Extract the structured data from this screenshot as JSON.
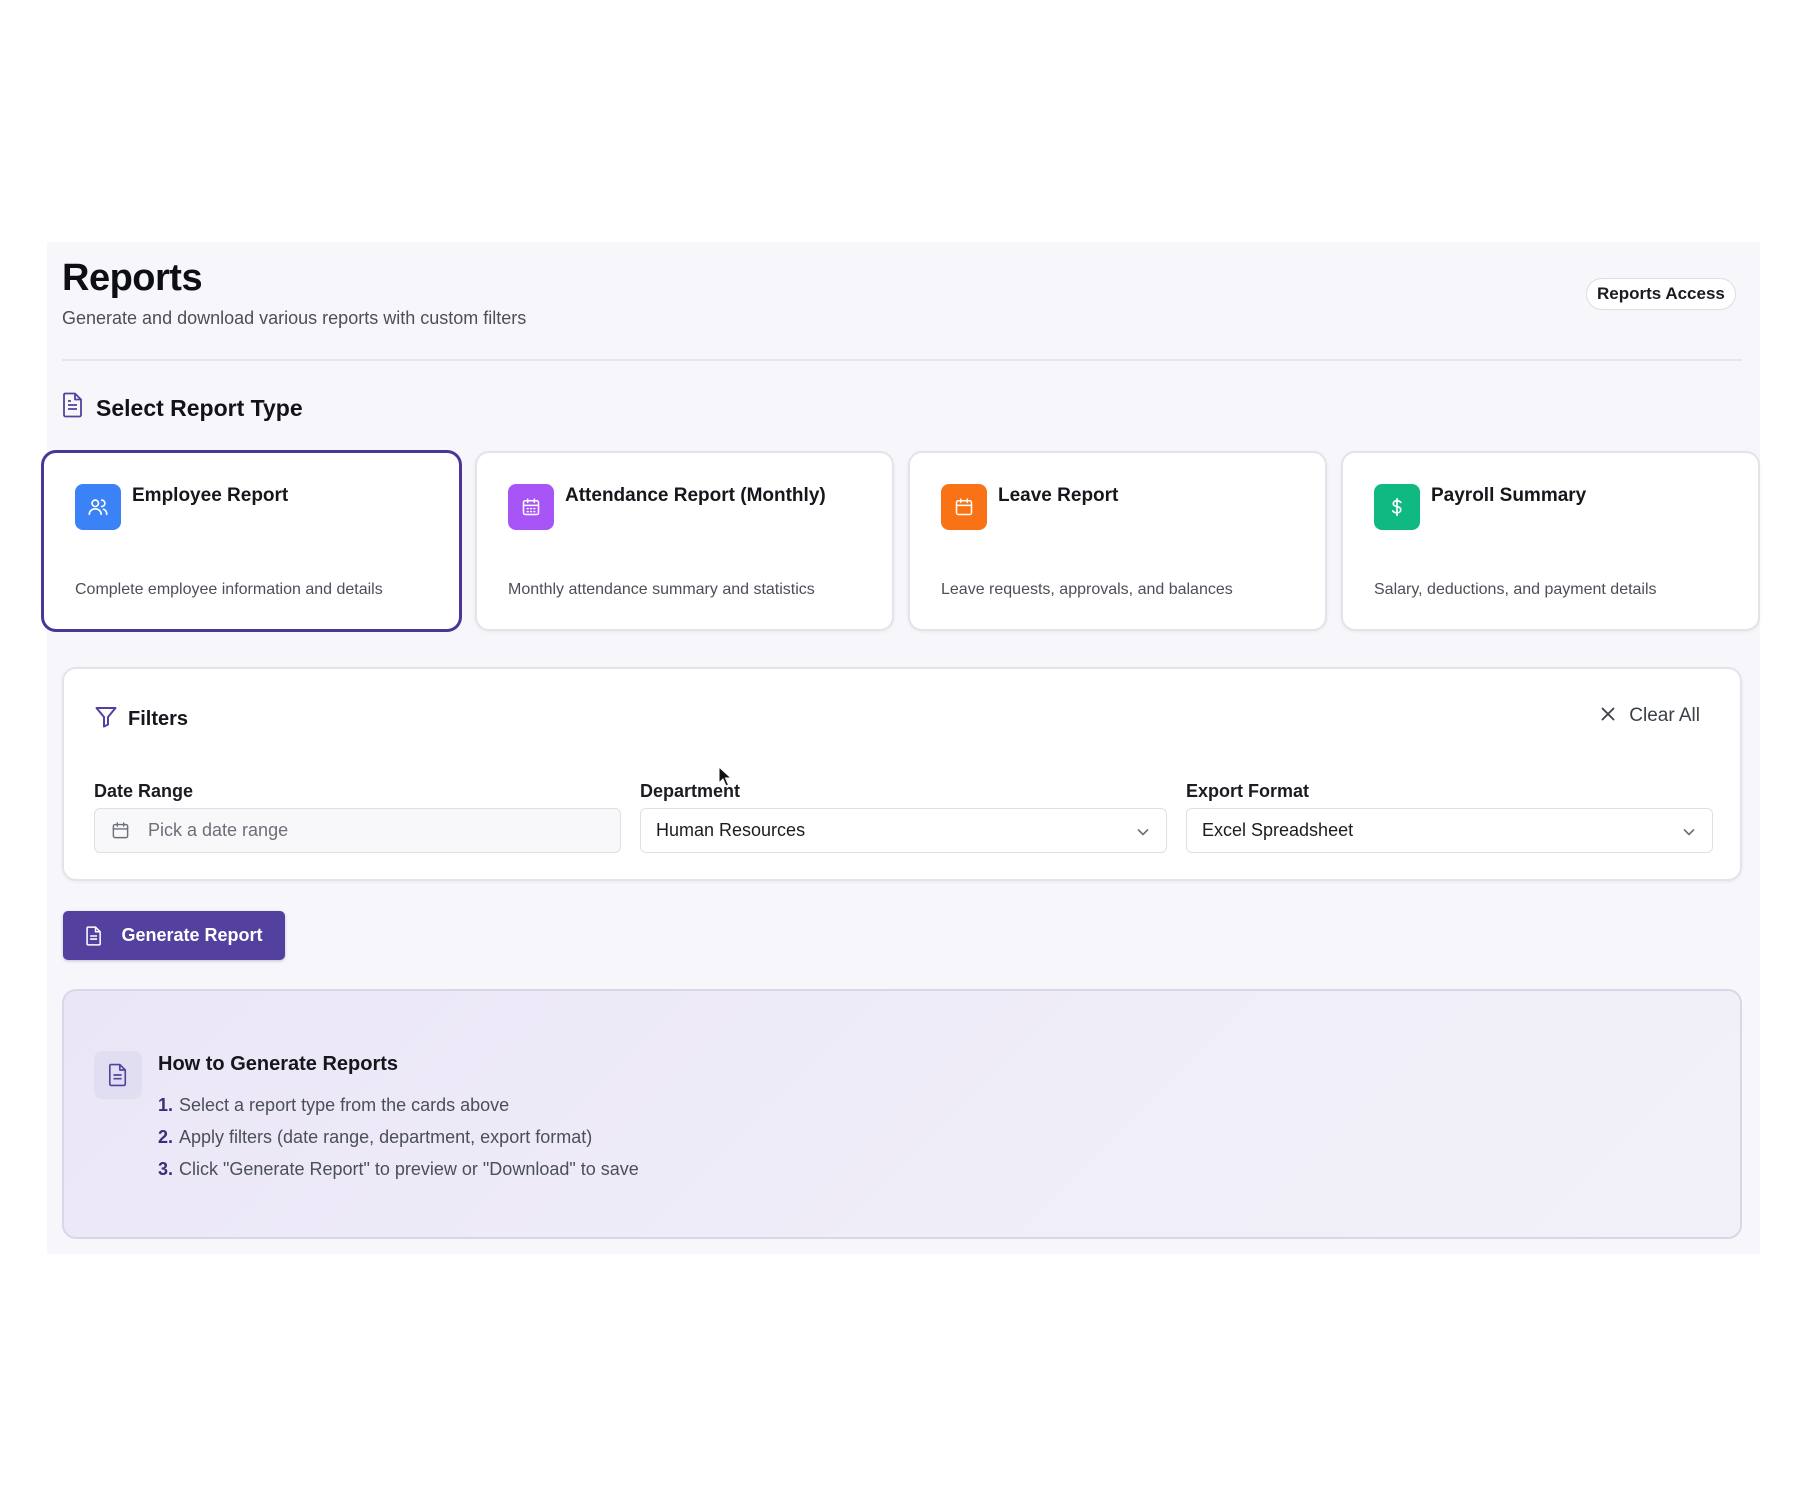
{
  "header": {
    "title": "Reports",
    "subtitle": "Generate and download various reports with custom filters",
    "access_badge": "Reports Access"
  },
  "report_type_section": {
    "heading": "Select Report Type",
    "icon": "file-text-icon"
  },
  "report_types": [
    {
      "name": "Employee Report",
      "description": "Complete employee information and details",
      "icon": "users-icon",
      "color": "#3b82f6",
      "selected": true
    },
    {
      "name": "Attendance Report (Monthly)",
      "description": "Monthly attendance summary and statistics",
      "icon": "calendar-grid-icon",
      "color": "#a855f7",
      "selected": false
    },
    {
      "name": "Leave Report",
      "description": "Leave requests, approvals, and balances",
      "icon": "calendar-icon",
      "color": "#f97316",
      "selected": false
    },
    {
      "name": "Payroll Summary",
      "description": "Salary, deductions, and payment details",
      "icon": "dollar-icon",
      "color": "#10b981",
      "selected": false
    }
  ],
  "filters": {
    "heading": "Filters",
    "clear_all_label": "Clear All",
    "date_range": {
      "label": "Date Range",
      "placeholder": "Pick a date range"
    },
    "department": {
      "label": "Department",
      "value": "Human Resources"
    },
    "export_format": {
      "label": "Export Format",
      "value": "Excel Spreadsheet"
    }
  },
  "generate_button": {
    "label": "Generate Report"
  },
  "howto": {
    "title": "How to Generate Reports",
    "steps": [
      {
        "num": "1.",
        "text": "Select a report type from the cards above"
      },
      {
        "num": "2.",
        "text": "Apply filters (date range, department, export format)"
      },
      {
        "num": "3.",
        "text": "Click \"Generate Report\" to preview or \"Download\" to save"
      }
    ]
  },
  "colors": {
    "accent": "#54409e",
    "selected_border": "#4b3596"
  }
}
